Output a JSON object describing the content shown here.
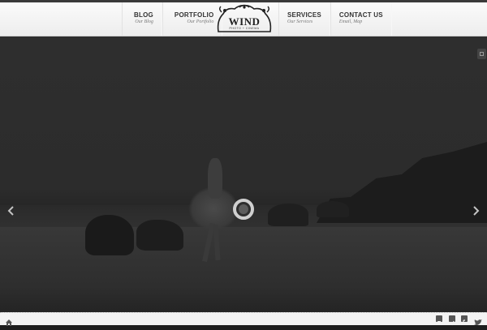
{
  "nav": {
    "left": [
      {
        "label": "BLOG",
        "sub": "Our Blog"
      },
      {
        "label": "PORTFOLIO",
        "sub": "Our Portfolio"
      }
    ],
    "right": [
      {
        "label": "SERVICES",
        "sub": "Our Services"
      },
      {
        "label": "CONTACT US",
        "sub": "Email, Map"
      }
    ]
  },
  "logo": {
    "text": "WIND",
    "sub": "PHOTO + CINEMA"
  },
  "slider": {
    "prev_icon": "chevron-left-icon",
    "next_icon": "chevron-right-icon",
    "loader_icon": "loading-ring-icon"
  },
  "footer": {
    "home_icon": "home-icon",
    "social": [
      "share-icon",
      "vimeo-icon",
      "facebook-icon",
      "twitter-icon"
    ]
  },
  "colors": {
    "header_bg": "#f4f4f4",
    "stage_bg": "#2c2c2c",
    "footer_bg": "#f3f3f3",
    "text": "#333333"
  }
}
